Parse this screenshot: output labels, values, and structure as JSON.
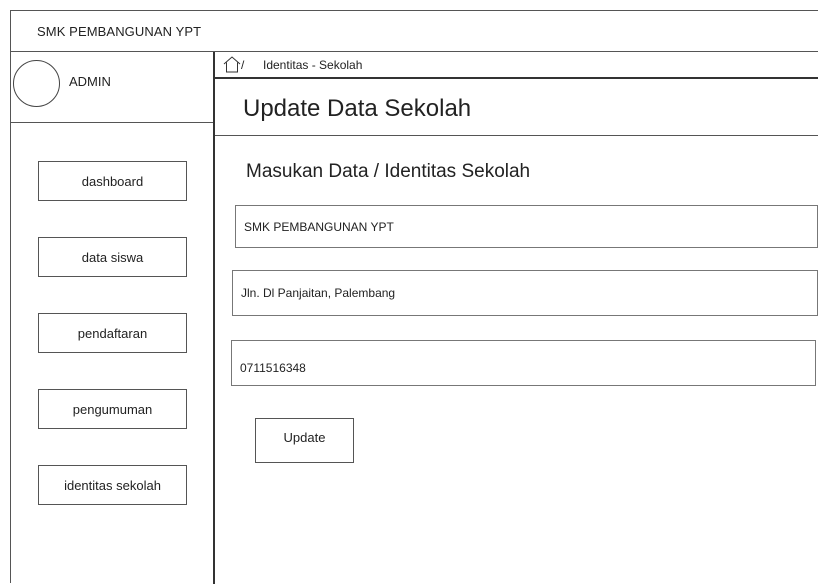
{
  "app": {
    "brand": "SMK PEMBANGUNAN YPT"
  },
  "sidebar": {
    "user_label": "ADMIN",
    "items": [
      {
        "label": "dashboard"
      },
      {
        "label": "data siswa"
      },
      {
        "label": "pendaftaran"
      },
      {
        "label": "pengumuman"
      },
      {
        "label": "identitas sekolah"
      }
    ]
  },
  "breadcrumb": {
    "icon": "home-icon",
    "separator": "/",
    "current": "Identitas - Sekolah"
  },
  "main": {
    "page_title": "Update Data Sekolah",
    "section_title": "Masukan Data / Identitas Sekolah",
    "fields": {
      "school_name": "SMK PEMBANGUNAN YPT",
      "address": "Jln. Dl Panjaitan, Palembang",
      "phone": "0711516348"
    },
    "update_label": "Update"
  }
}
